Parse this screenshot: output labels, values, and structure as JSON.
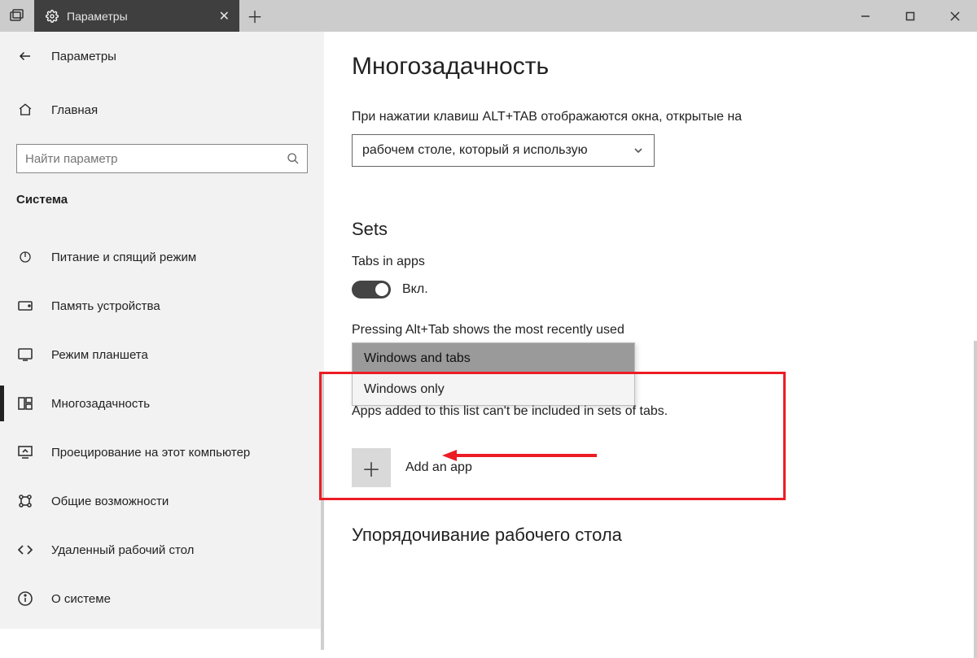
{
  "titlebar": {
    "tab_label": "Параметры"
  },
  "sidebar": {
    "back_label": "Параметры",
    "home_label": "Главная",
    "search_placeholder": "Найти параметр",
    "section_heading": "Система",
    "items": [
      {
        "label": "Питание и спящий режим"
      },
      {
        "label": "Память устройства"
      },
      {
        "label": "Режим планшета"
      },
      {
        "label": "Многозадачность"
      },
      {
        "label": "Проецирование на этот компьютер"
      },
      {
        "label": "Общие возможности"
      },
      {
        "label": "Удаленный рабочий стол"
      },
      {
        "label": "О системе"
      }
    ]
  },
  "main": {
    "title": "Многозадачность",
    "alttab_label": "При нажатии клавиш ALT+TAB отображаются окна, открытые на",
    "alttab_value": "рабочем столе, который я использую",
    "sets_heading": "Sets",
    "tabs_in_apps_label": "Tabs in apps",
    "toggle_on_label": "Вкл.",
    "pressing_label": "Pressing Alt+Tab shows the most recently used",
    "opt1": "Windows and tabs",
    "opt2": "Windows only",
    "after_combo": "Apps added to this list can't be included in sets of tabs.",
    "add_app_label": "Add an app",
    "ordering_heading": "Упорядочивание рабочего стола"
  }
}
